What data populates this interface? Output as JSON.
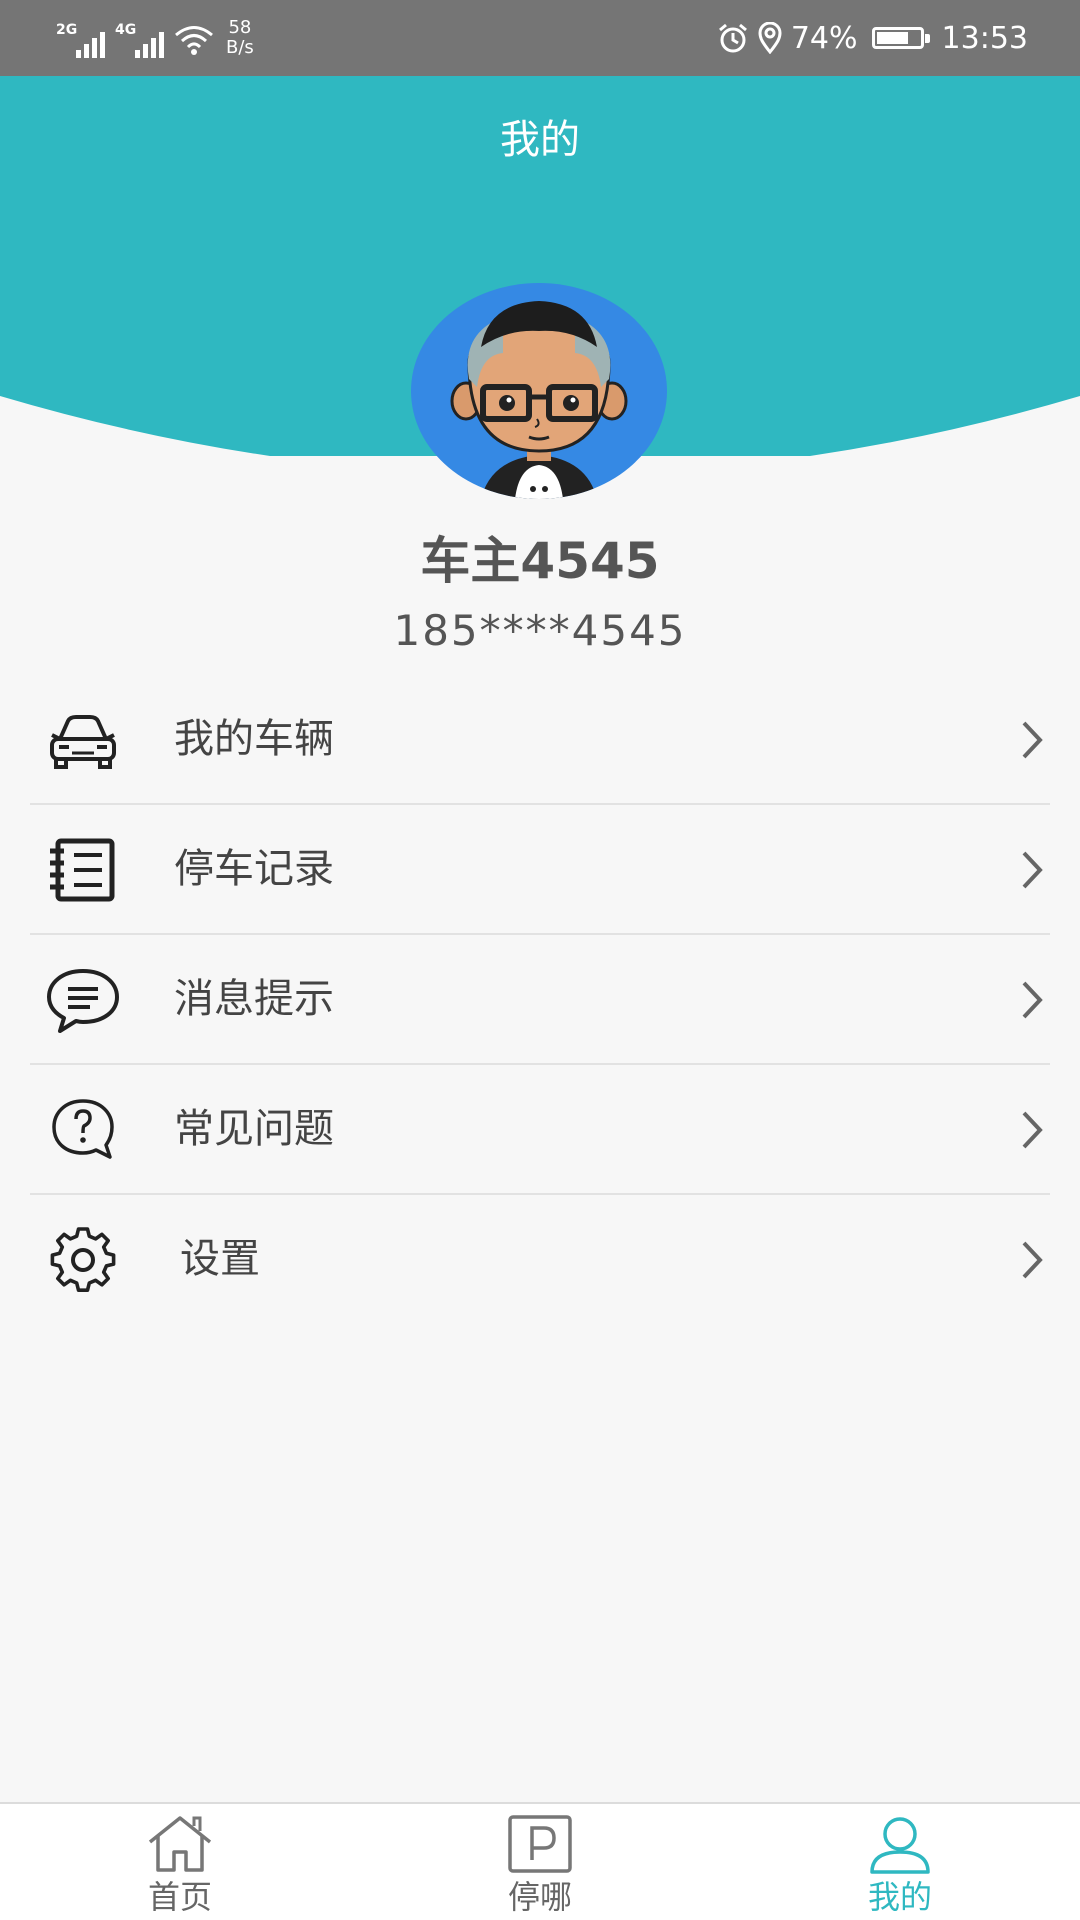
{
  "status_bar": {
    "sim1_type": "2G",
    "sim2_type": "4G",
    "net_speed_value": "58",
    "net_speed_unit": "B/s",
    "battery_percent": "74%",
    "battery_level": 0.74,
    "time": "13:53"
  },
  "header": {
    "title": "我的",
    "background_color": "#2fb8c1"
  },
  "profile": {
    "name": "车主4545",
    "phone": "185****4545",
    "avatar_icon": "cartoon-avatar-glasses"
  },
  "menu": {
    "items": [
      {
        "label": "我的车辆",
        "icon": "car-icon"
      },
      {
        "label": "停车记录",
        "icon": "notebook-icon"
      },
      {
        "label": "消息提示",
        "icon": "chat-bubble-icon"
      },
      {
        "label": "常见问题",
        "icon": "question-bubble-icon"
      },
      {
        "label": "设置",
        "icon": "gear-icon"
      }
    ]
  },
  "tabbar": {
    "tabs": [
      {
        "label": "首页",
        "icon": "home-icon",
        "active": false
      },
      {
        "label": "停哪",
        "icon": "parking-icon",
        "active": false
      },
      {
        "label": "我的",
        "icon": "person-icon",
        "active": true
      }
    ],
    "active_color": "#2fb8c1",
    "inactive_color": "#666666"
  }
}
